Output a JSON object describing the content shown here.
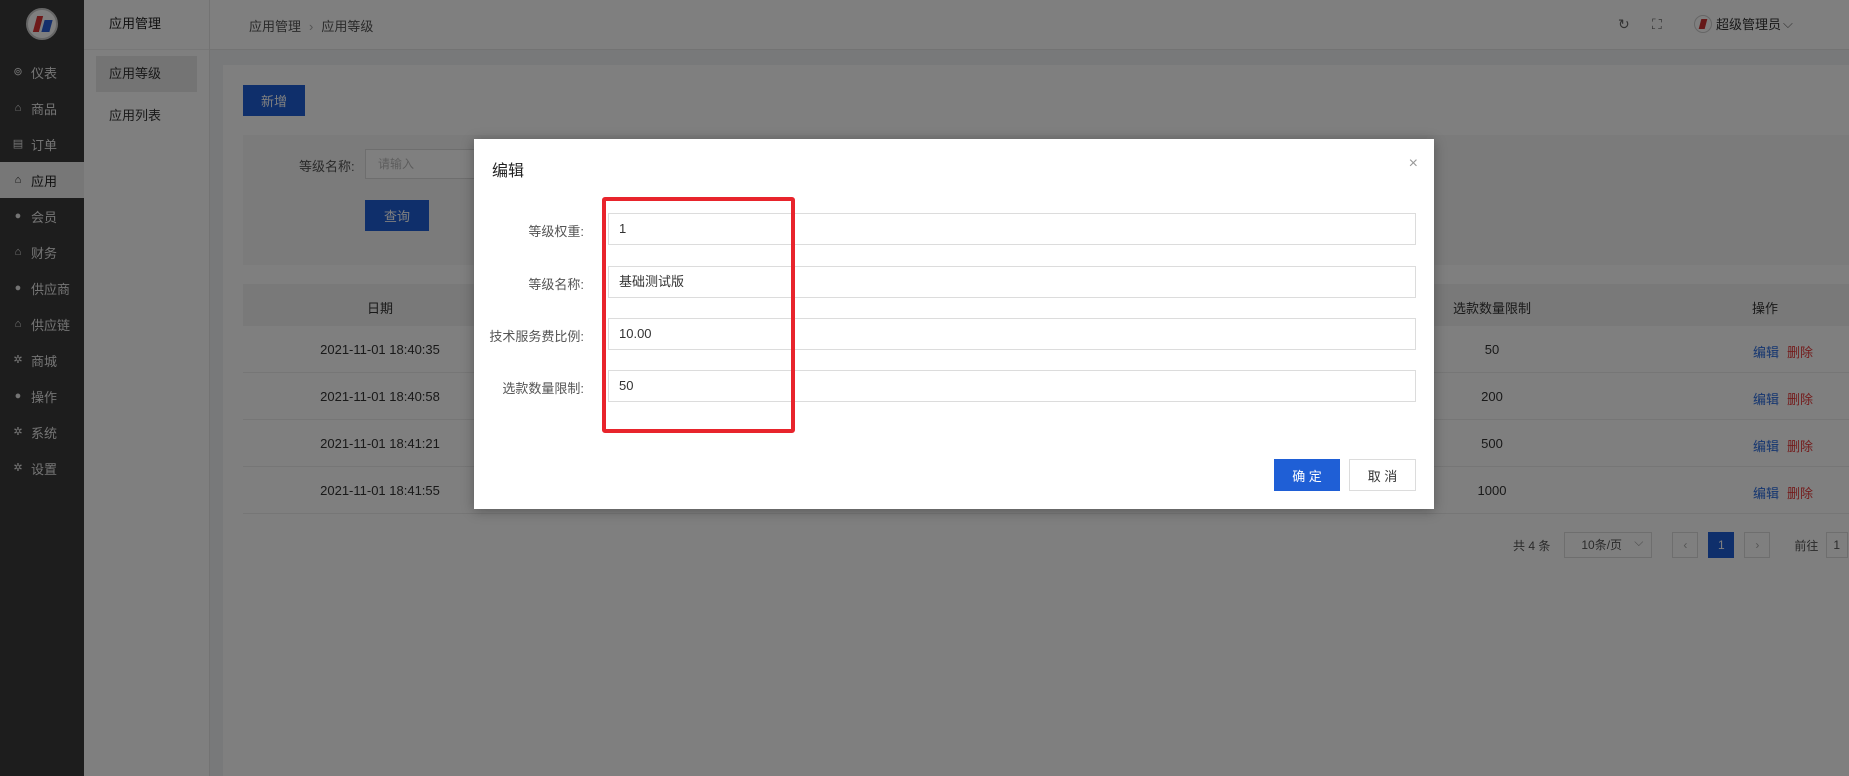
{
  "nav": {
    "items": [
      {
        "label": "仪表",
        "icon": "dashboard-icon"
      },
      {
        "label": "商品",
        "icon": "bag-icon"
      },
      {
        "label": "订单",
        "icon": "clipboard-icon"
      },
      {
        "label": "应用",
        "icon": "bag-icon"
      },
      {
        "label": "会员",
        "icon": "user-icon"
      },
      {
        "label": "财务",
        "icon": "bag-icon"
      },
      {
        "label": "供应商",
        "icon": "user-icon"
      },
      {
        "label": "供应链",
        "icon": "bag-icon"
      },
      {
        "label": "商城",
        "icon": "gear-icon"
      },
      {
        "label": "操作",
        "icon": "user-icon"
      },
      {
        "label": "系统",
        "icon": "gear-icon"
      },
      {
        "label": "设置",
        "icon": "gear-icon"
      }
    ],
    "active_index": 3
  },
  "subnav": {
    "title": "应用管理",
    "items": [
      "应用等级",
      "应用列表"
    ]
  },
  "header": {
    "breadcrumb": [
      "应用管理",
      "应用等级"
    ],
    "user": "超级管理员"
  },
  "toolbar": {
    "new_label": "新增"
  },
  "search": {
    "label": "等级名称:",
    "placeholder": "请输入",
    "query_label": "查询"
  },
  "table": {
    "columns": {
      "date": "日期",
      "limit": "选款数量限制",
      "ops": "操作"
    },
    "rows": [
      {
        "date": "2021-11-01 18:40:35",
        "limit": "50"
      },
      {
        "date": "2021-11-01 18:40:58",
        "limit": "200"
      },
      {
        "date": "2021-11-01 18:41:21",
        "limit": "500"
      },
      {
        "date": "2021-11-01 18:41:55",
        "limit": "1000"
      }
    ],
    "edit_label": "编辑",
    "delete_label": "删除"
  },
  "pagination": {
    "total": "共 4 条",
    "page_size": "10条/页",
    "prev": "‹",
    "current": "1",
    "next": "›",
    "goto_label": "前往",
    "goto_value": "1"
  },
  "modal": {
    "title": "编辑",
    "close": "×",
    "fields": [
      {
        "label": "等级权重:",
        "value": "1"
      },
      {
        "label": "等级名称:",
        "value": "基础测试版"
      },
      {
        "label": "技术服务费比例:",
        "value": "10.00"
      },
      {
        "label": "选款数量限制:",
        "value": "50"
      }
    ],
    "ok_label": "确 定",
    "cancel_label": "取 消"
  },
  "colors": {
    "primary": "#1f5fd6",
    "danger": "#e83a3a",
    "highlight": "#e8242c",
    "sidebar": "#3a3a3a"
  }
}
